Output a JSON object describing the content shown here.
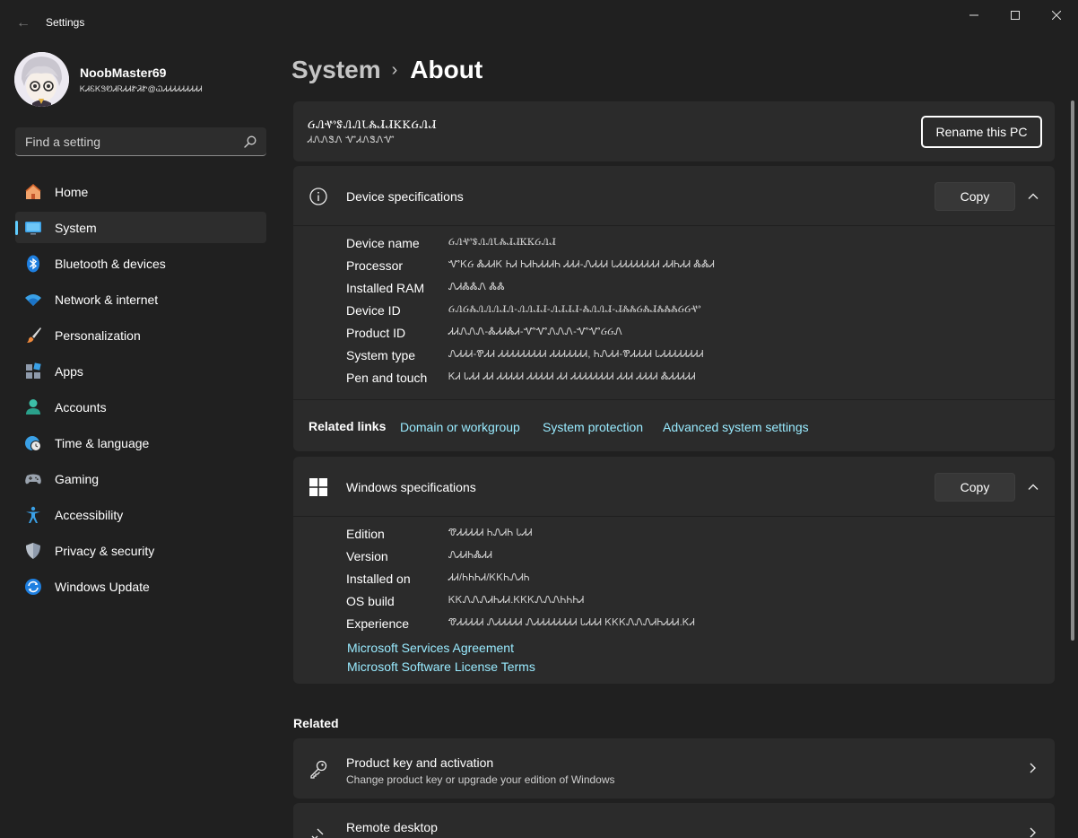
{
  "window": {
    "title": "Settings",
    "back_glyph": "←",
    "controls": [
      "minimize",
      "maximize",
      "close"
    ]
  },
  "profile": {
    "name": "NoobMaster69",
    "email": "ᏦᏗᏋᏦᏕᏬᏗᏒᏗᏗᏑᏘᏑ@ᏇᏗᏗᏗᏗᏗᏗᏗᏗᏗ"
  },
  "search": {
    "placeholder": "Find a setting",
    "icon": "search-icon"
  },
  "nav": {
    "items": [
      {
        "label": "Home",
        "icon": "home-icon",
        "selected": false
      },
      {
        "label": "System",
        "icon": "system-icon",
        "selected": true
      },
      {
        "label": "Bluetooth & devices",
        "icon": "bluetooth-icon",
        "selected": false
      },
      {
        "label": "Network & internet",
        "icon": "wifi-icon",
        "selected": false
      },
      {
        "label": "Personalization",
        "icon": "brush-icon",
        "selected": false
      },
      {
        "label": "Apps",
        "icon": "apps-icon",
        "selected": false
      },
      {
        "label": "Accounts",
        "icon": "person-icon",
        "selected": false
      },
      {
        "label": "Time & language",
        "icon": "clock-globe-icon",
        "selected": false
      },
      {
        "label": "Gaming",
        "icon": "gamepad-icon",
        "selected": false
      },
      {
        "label": "Accessibility",
        "icon": "accessibility-icon",
        "selected": false
      },
      {
        "label": "Privacy & security",
        "icon": "shield-icon",
        "selected": false
      },
      {
        "label": "Windows Update",
        "icon": "update-icon",
        "selected": false
      }
    ]
  },
  "breadcrumb": {
    "parent": "System",
    "separator": "›",
    "current": "About"
  },
  "pc_card": {
    "pc_name": "ᏵᏁᏉᏕᏁᏁᏓᏜᏗᏗᏦᏦᏵᏁᏗ",
    "pc_model": "ᏗᏁᏁᏕᏁ ᏉᏗᏁᏕᏁᏉ",
    "rename_label": "Rename this PC"
  },
  "device_specs": {
    "title": "Device specifications",
    "icon": "info-icon",
    "copy_label": "Copy",
    "rows": [
      {
        "label": "Device name",
        "value": "ᏵᏁᏉᏕᏁᏁᏓᏜᏗᏗᏦᏦᏵᏁᏗ"
      },
      {
        "label": "Processor",
        "value": "ᏉᏦᏵ ᏜᏗᏗᏦ ᏂᏗ ᏂᏗᏂᏗᏗᏗᏂ ᏗᏗᏗ-ᏁᏗᏗᏗ ᏓᏗᏗᏗᏗᏗᏗᏗᏗ                    ᏗᏗᏂᏗᏗ ᏜᏜᏗ"
      },
      {
        "label": "Installed RAM",
        "value": "ᏁᏗᏜᏜᏁ ᏜᏜ"
      },
      {
        "label": "Device ID",
        "value": "ᏵᏁᏵᏜᏁᏁᏁᏗᏁ-ᏁᏁᏗᏗ-ᏁᏗᏗᏗ-ᏜᏁᏁᏗ-ᏗᏜᏜᏵᏜᏗᏜᏜᏜᏵᏵᏉ"
      },
      {
        "label": "Product ID",
        "value": "ᏗᏗᏁᏁᏁ-ᏜᏗᏗᏜᏗ-ᏉᏉᏁᏁᏁ-ᏉᏉᏵᏵᏁ"
      },
      {
        "label": "System type",
        "value": "ᏁᏗᏗᏗ-ᏈᏗᏗ ᏗᏗᏗᏗᏗᏗᏗᏗᏗ ᏗᏗᏗᏗᏗᏗᏗ, ᏂᏁᏗᏗ-ᏈᏗᏗᏗᏗ ᏓᏗᏗᏗᏗᏗᏗᏗᏗ"
      },
      {
        "label": "Pen and touch",
        "value": "ᏦᏗ ᏓᏗᏗ ᏗᏗ ᏗᏗᏗᏗᏗ ᏗᏗᏗᏗᏗ ᏗᏗ ᏗᏗᏗᏗᏗᏗᏗᏗ ᏗᏗᏗ ᏗᏗᏗᏗ ᏜᏗᏗᏗᏗᏗ"
      }
    ],
    "related_label": "Related links",
    "related_links": [
      "Domain or workgroup",
      "System protection",
      "Advanced system settings"
    ]
  },
  "windows_specs": {
    "title": "Windows specifications",
    "icon": "windows-logo-icon",
    "copy_label": "Copy",
    "rows": [
      {
        "label": "Edition",
        "value": "ᏡᏗᏗᏗᏗᏗ ᏂᏁᏗᏂ ᏓᏗᏗ"
      },
      {
        "label": "Version",
        "value": "ᏁᏗᏗᏂᏜᏗᏗ"
      },
      {
        "label": "Installed on",
        "value": "ᏗᏗ/ᏂᏂᏂᏗ/ᏦᏦᏂᏁᏗᏂ"
      },
      {
        "label": "OS build",
        "value": "ᏦᏦᏁᏁᏁᏗᏂᏗᏗ.ᏦᏦᏦᏁᏁᏁᏂᏂᏂᏗ"
      },
      {
        "label": "Experience",
        "value": "ᏡᏗᏗᏗᏗᏗ ᏁᏗᏗᏗᏗᏗ ᏁᏗᏗᏗᏗᏗᏗᏗᏗ ᏓᏗᏗᏗ ᏦᏦᏦᏁᏁᏁᏗᏂᏗᏗᏗ.ᏦᏗ"
      }
    ],
    "links": [
      "Microsoft Services Agreement",
      "Microsoft Software License Terms"
    ]
  },
  "related": {
    "title": "Related",
    "items": [
      {
        "title": "Product key and activation",
        "subtitle": "Change product key or upgrade your edition of Windows",
        "icon": "key-icon"
      },
      {
        "title": "Remote desktop",
        "subtitle": "",
        "icon": "remote-desktop-icon"
      }
    ]
  },
  "colors": {
    "background": "#202020",
    "card": "#2b2b2b",
    "accent": "#60cdff",
    "link": "#99ebff"
  }
}
